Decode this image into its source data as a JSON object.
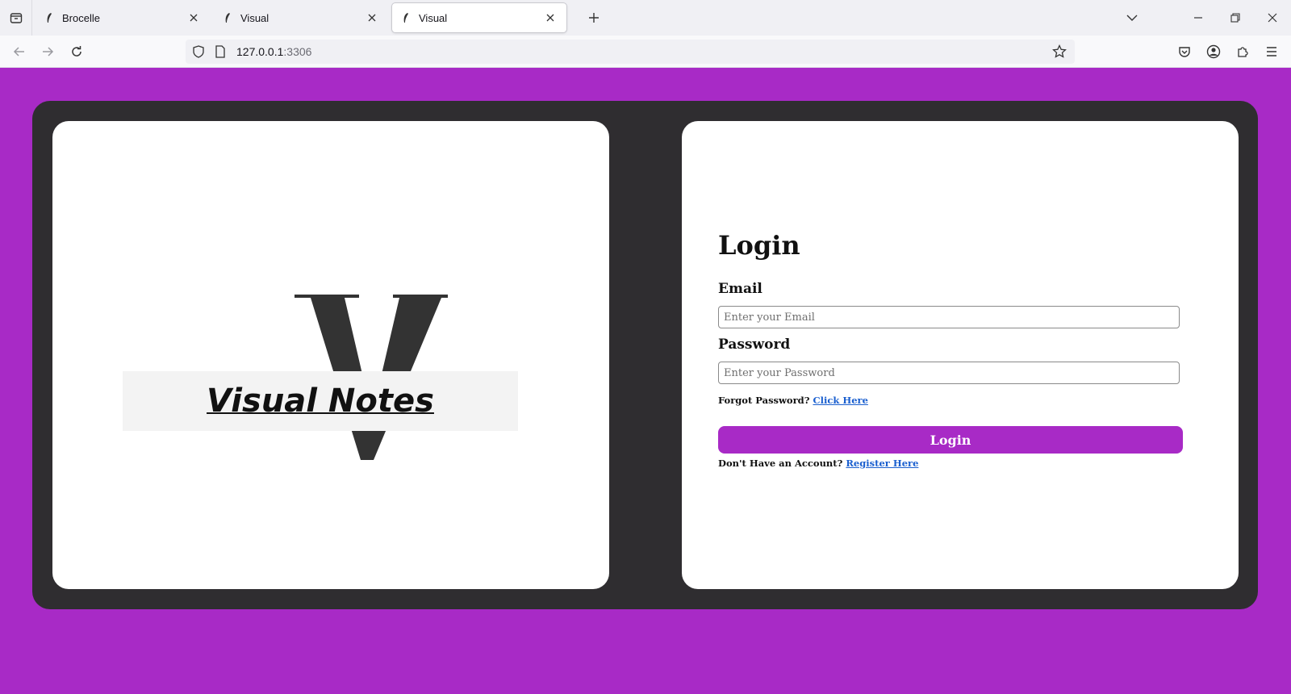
{
  "browser": {
    "tabs": [
      {
        "title": "Brocelle",
        "active": false
      },
      {
        "title": "Visual",
        "active": false
      },
      {
        "title": "Visual",
        "active": true
      }
    ],
    "url_host": "127.0.0.1",
    "url_port": ":3306"
  },
  "brand": {
    "name": "Visual Notes",
    "logo_letter": "V"
  },
  "login": {
    "title": "Login",
    "email_label": "Email",
    "email_placeholder": "Enter your Email",
    "password_label": "Password",
    "password_placeholder": "Enter your Password",
    "forgot_text": "Forgot Password?",
    "forgot_link": "Click Here",
    "submit_label": "Login",
    "register_text": "Don't Have an Account?",
    "register_link": "Register Here"
  },
  "colors": {
    "page_background": "#a82ac6",
    "frame": "#2f2d30",
    "accent": "#a82ac6",
    "link": "#1a5fcf"
  }
}
